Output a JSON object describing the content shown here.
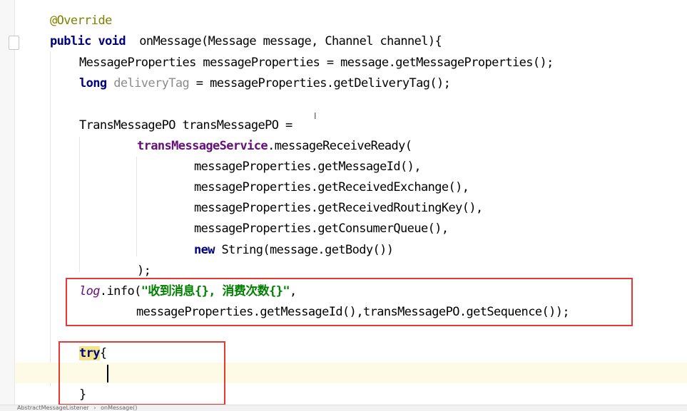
{
  "colors": {
    "keyword": "#000080",
    "annotation": "#808000",
    "field": "#660e7a",
    "unused": "#8c8c8c",
    "string": "#008000",
    "highlight_box": "#e53935",
    "caret_line": "#fdfae6"
  },
  "code": {
    "l1": {
      "annotation": "@Override"
    },
    "l2": {
      "kw": "public void",
      "rest": "  onMessage(Message message, Channel channel){"
    },
    "l3": {
      "text": "MessageProperties messageProperties = message.getMessageProperties();"
    },
    "l4": {
      "kw": "long",
      "var": "deliveryTag",
      "rest": " = messageProperties.getDeliveryTag();"
    },
    "l5": {
      "text": "TransMessagePO transMessagePO ="
    },
    "l6": {
      "field": "transMessageService",
      "rest": ".messageReceiveReady("
    },
    "l7": {
      "text": "messageProperties.getMessageId(),"
    },
    "l8": {
      "text": "messageProperties.getReceivedExchange(),"
    },
    "l9": {
      "text": "messageProperties.getReceivedRoutingKey(),"
    },
    "l10": {
      "text": "messageProperties.getConsumerQueue(),"
    },
    "l11": {
      "kw": "new",
      "rest": " String(message.getBody())"
    },
    "l12": {
      "text": ");"
    },
    "l13": {
      "log": "log",
      "method": ".info(",
      "str": "\"收到消息{}, 消费次数{}\"",
      "rest": ","
    },
    "l14": {
      "text": "messageProperties.getMessageId(),transMessagePO.getSequence());"
    },
    "l15": {
      "kw": "try",
      "brace": "{"
    },
    "l16": {
      "text": "}"
    }
  },
  "breadcrumb": {
    "class_name": "AbstractMessageListener",
    "separator": "›",
    "method_name": "onMessage()"
  }
}
